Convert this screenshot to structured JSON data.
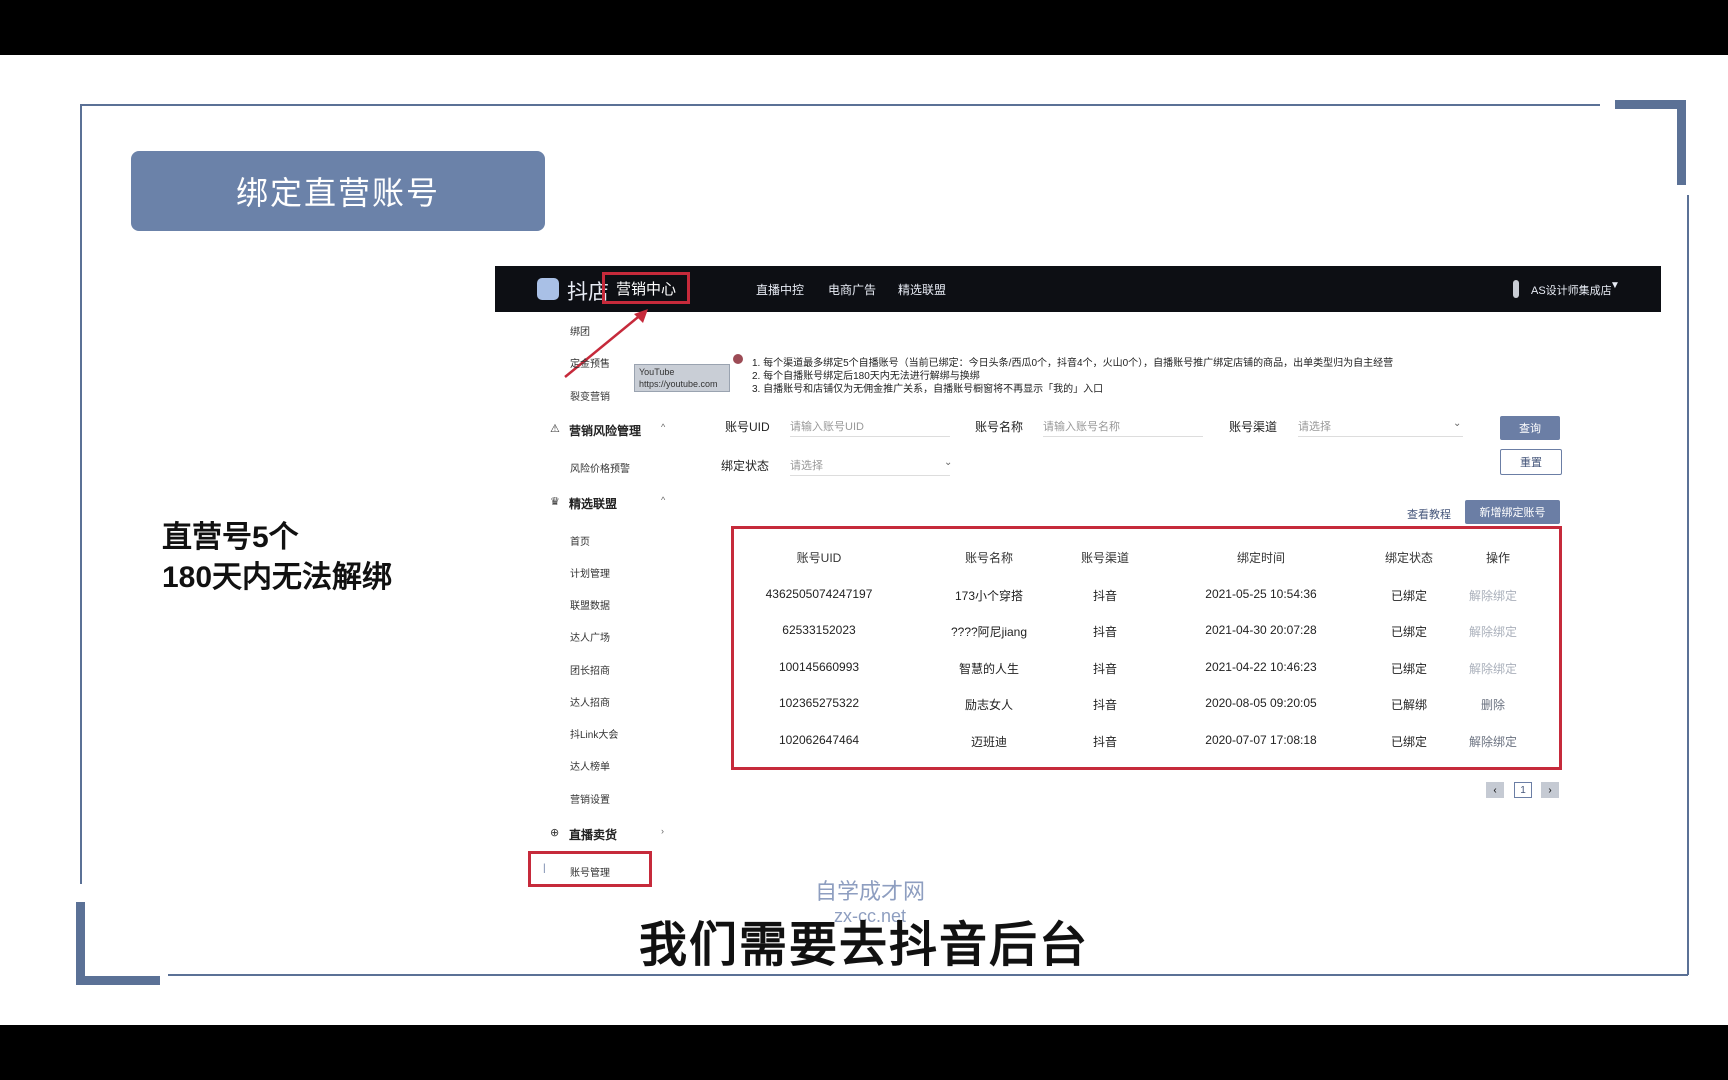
{
  "slide": {
    "title": "绑定直营账号",
    "note_line1": "直营号5个",
    "note_line2": "180天内无法解绑",
    "subtitle": "我们需要去抖音后台",
    "watermark_line1": "自学成才网",
    "watermark_line2": "zx-cc.net"
  },
  "topnav": {
    "logo_text": "抖店",
    "active": "营销中心",
    "items": [
      "直播中控",
      "电商广告",
      "精选联盟"
    ],
    "shop": "AS设计师集成店"
  },
  "youtube_badge": {
    "line1": "YouTube",
    "line2": "https://youtube.com"
  },
  "sidebar": {
    "top_items": [
      "绑团",
      "定金预售",
      "裂变营销"
    ],
    "risk_group": "营销风险管理",
    "risk_items": [
      "风险价格预警"
    ],
    "alliance_group": "精选联盟",
    "alliance_items": [
      "首页",
      "计划管理",
      "联盟数据",
      "达人广场",
      "团长招商",
      "达人招商",
      "抖Link大会",
      "达人榜单",
      "营销设置"
    ],
    "live_group": "直播卖货",
    "account_item": "账号管理"
  },
  "notice": {
    "line1": "1. 每个渠道最多绑定5个自播账号（当前已绑定：今日头条/西瓜0个，抖音4个，火山0个），自播账号推广绑定店铺的商品，出单类型归为自主经营",
    "line2": "2. 每个自播账号绑定后180天内无法进行解绑与换绑",
    "line3": "3. 自播账号和店铺仅为无佣金推广关系，自播账号橱窗将不再显示「我的」入口"
  },
  "filters": {
    "uid_label": "账号UID",
    "uid_placeholder": "请输入账号UID",
    "name_label": "账号名称",
    "name_placeholder": "请输入账号名称",
    "channel_label": "账号渠道",
    "channel_placeholder": "请选择",
    "status_label": "绑定状态",
    "status_placeholder": "请选择",
    "query_button": "查询",
    "reset_button": "重置",
    "tutorial_link": "查看教程",
    "add_button": "新增绑定账号"
  },
  "table": {
    "headers": [
      "账号UID",
      "账号名称",
      "账号渠道",
      "绑定时间",
      "绑定状态",
      "操作"
    ],
    "rows": [
      [
        "4362505074247197",
        "173小个穿搭",
        "抖音",
        "2021-05-25 10:54:36",
        "已绑定",
        "解除绑定"
      ],
      [
        "62533152023",
        "????阿尼jiang",
        "抖音",
        "2021-04-30 20:07:28",
        "已绑定",
        "解除绑定"
      ],
      [
        "100145660993",
        "智慧的人生",
        "抖音",
        "2021-04-22 10:46:23",
        "已绑定",
        "解除绑定"
      ],
      [
        "102365275322",
        "励志女人",
        "抖音",
        "2020-08-05 09:20:05",
        "已解绑",
        "删除"
      ],
      [
        "102062647464",
        "迈班迪",
        "抖音",
        "2020-07-07 17:08:18",
        "已绑定",
        "解除绑定"
      ]
    ]
  },
  "pagination": {
    "current": "1"
  }
}
